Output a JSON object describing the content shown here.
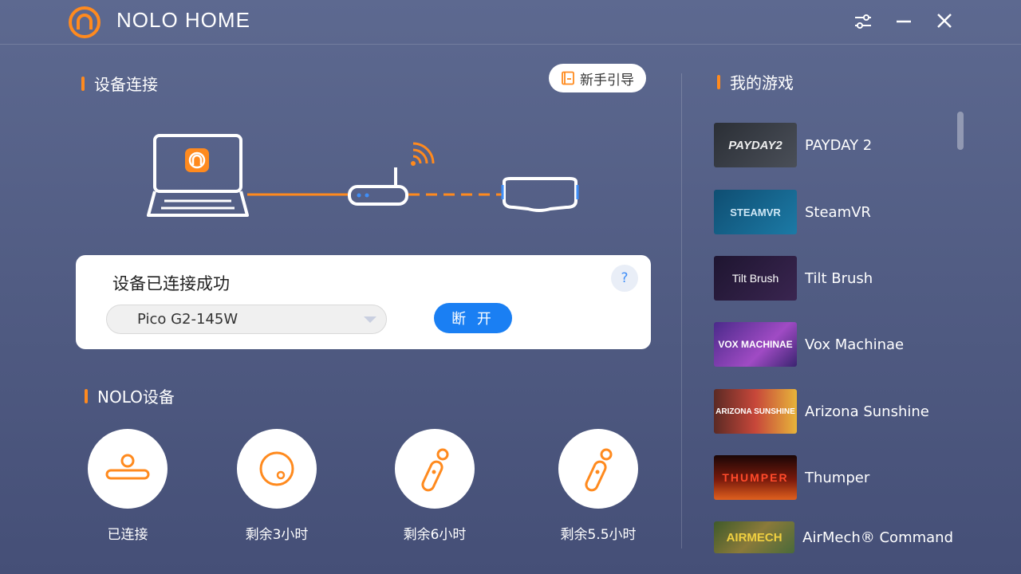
{
  "app": {
    "title": "NOLO HOME",
    "accent": "#ff8a1e",
    "blue": "#1a7ff3"
  },
  "titlebar": {
    "settings_icon": "sliders-icon",
    "minimize_icon": "minimize-icon",
    "close_icon": "close-icon"
  },
  "connection": {
    "section_title": "设备连接",
    "guide_button": "新手引导",
    "status_text": "设备已连接成功",
    "selected_device": "Pico G2-145W",
    "disconnect_button": "断 开",
    "help": "?"
  },
  "nolo_devices": {
    "section_title": "NOLO设备",
    "items": [
      {
        "icon": "base-station-icon",
        "status": "已连接"
      },
      {
        "icon": "headset-marker-icon",
        "status": "剩余3小时"
      },
      {
        "icon": "controller-icon",
        "status": "剩余6小时"
      },
      {
        "icon": "controller-icon",
        "status": "剩余5.5小时"
      }
    ]
  },
  "games": {
    "section_title": "我的游戏",
    "items": [
      {
        "name": "PAYDAY 2",
        "thumb_text": "PAYDAY2"
      },
      {
        "name": "SteamVR",
        "thumb_text": "STEAMVR"
      },
      {
        "name": "Tilt Brush",
        "thumb_text": "Tilt Brush"
      },
      {
        "name": "Vox Machinae",
        "thumb_text": "VOX MACHINAE"
      },
      {
        "name": "Arizona Sunshine",
        "thumb_text": "ARIZONA SUNSHINE"
      },
      {
        "name": "Thumper",
        "thumb_text": "THUMPER"
      },
      {
        "name": "AirMech® Command",
        "thumb_text": "AIRMECH"
      }
    ]
  }
}
